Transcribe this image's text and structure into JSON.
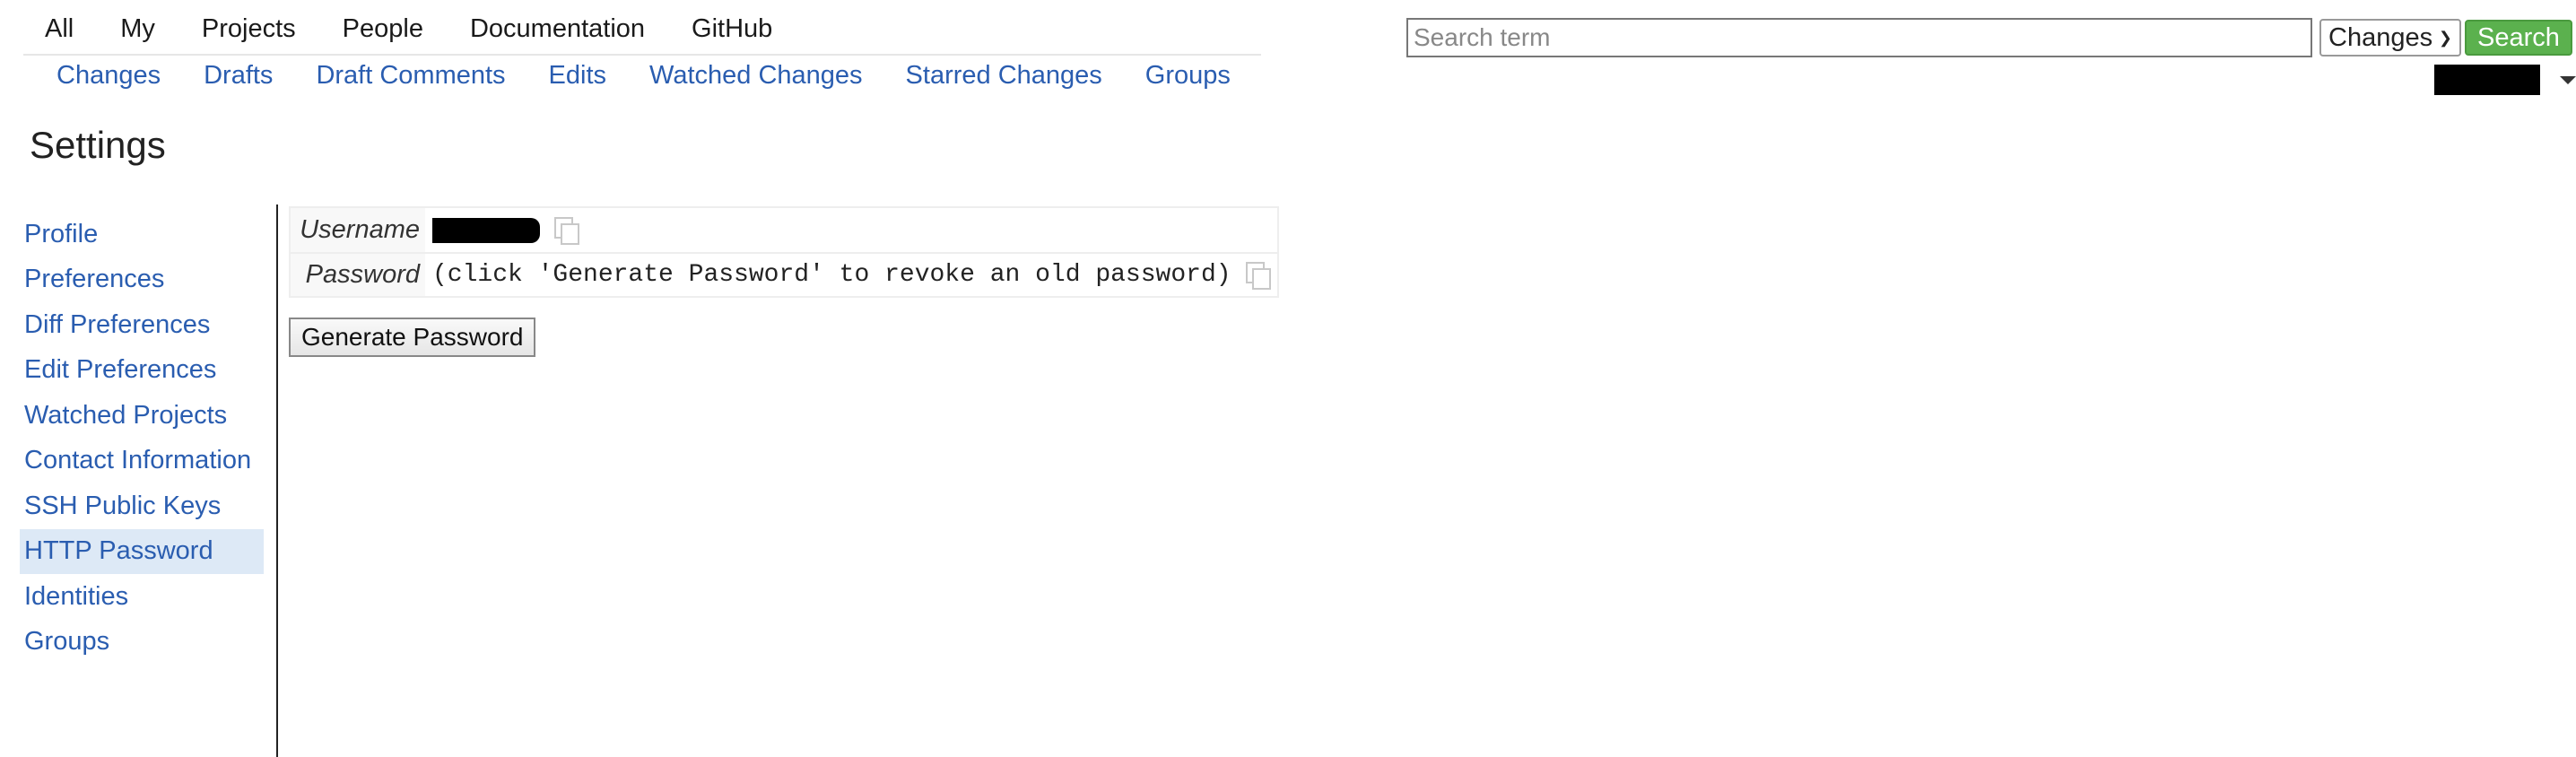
{
  "top_nav": [
    "All",
    "My",
    "Projects",
    "People",
    "Documentation",
    "GitHub"
  ],
  "sub_nav": [
    "Changes",
    "Drafts",
    "Draft Comments",
    "Edits",
    "Watched Changes",
    "Starred Changes",
    "Groups"
  ],
  "search": {
    "placeholder": "Search term",
    "scope": "Changes",
    "button": "Search"
  },
  "page_title": "Settings",
  "sidebar": {
    "items": [
      {
        "label": "Profile"
      },
      {
        "label": "Preferences"
      },
      {
        "label": "Diff Preferences"
      },
      {
        "label": "Edit Preferences"
      },
      {
        "label": "Watched Projects"
      },
      {
        "label": "Contact Information"
      },
      {
        "label": "SSH Public Keys"
      },
      {
        "label": "HTTP Password"
      },
      {
        "label": "Identities"
      },
      {
        "label": "Groups"
      }
    ],
    "active": "HTTP Password"
  },
  "credentials": {
    "username_label": "Username",
    "password_label": "Password",
    "password_value": "(click 'Generate Password' to revoke an old password)"
  },
  "generate_button": "Generate Password",
  "colors": {
    "link": "#2a5db0",
    "search_button": "#5bb14e",
    "active_item": "#dde9f6"
  }
}
